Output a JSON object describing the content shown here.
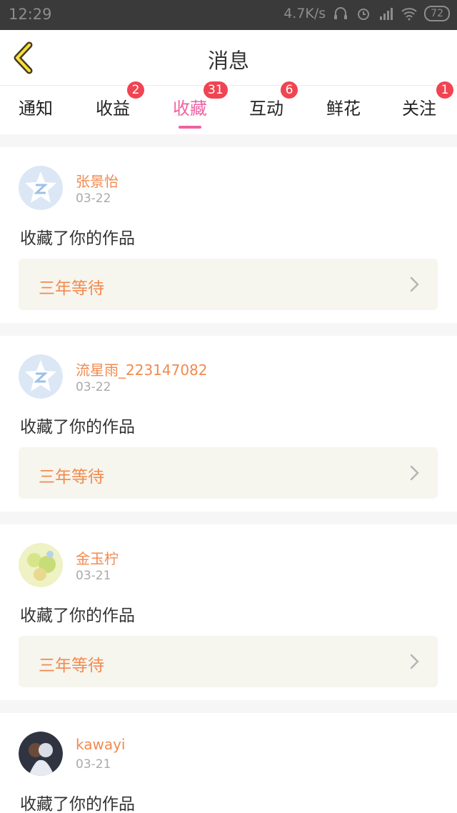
{
  "status_bar": {
    "time": "12:29",
    "net_speed": "4.7K/s",
    "battery": "72"
  },
  "header": {
    "title": "消息",
    "back_icon": "chevron-left-icon"
  },
  "tabs": [
    {
      "label": "通知",
      "badge": ""
    },
    {
      "label": "收益",
      "badge": "2"
    },
    {
      "label": "收藏",
      "badge": "31",
      "active": true
    },
    {
      "label": "互动",
      "badge": "6"
    },
    {
      "label": "鲜花",
      "badge": ""
    },
    {
      "label": "关注",
      "badge": "1"
    }
  ],
  "colors": {
    "accent": "#f062a2",
    "name_orange": "#f28a4f",
    "badge_red": "#f04452"
  },
  "messages": [
    {
      "name": "张景怡",
      "date": "03-22",
      "action": "收藏了你的作品",
      "work": "三年等待"
    },
    {
      "name": "流星雨_223147082",
      "date": "03-22",
      "action": "收藏了你的作品",
      "work": "三年等待"
    },
    {
      "name": "金玉柠",
      "date": "03-21",
      "action": "收藏了你的作品",
      "work": "三年等待"
    },
    {
      "name": "kawayi",
      "date": "03-21",
      "action": "收藏了你的作品",
      "work": ""
    }
  ]
}
